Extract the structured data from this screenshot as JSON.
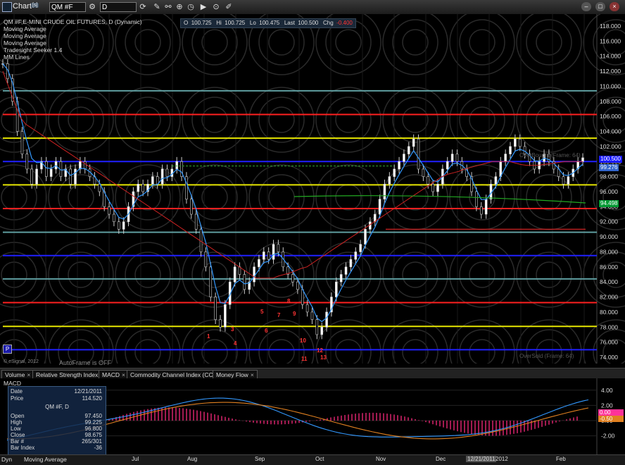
{
  "window": {
    "title": "Chart",
    "badge": "[s]",
    "symbol": "QM #F",
    "interval": "D"
  },
  "legend": {
    "lines": [
      "QM #F,E-MINI CRUDE OIL FUTURES, D (Dynamic)",
      "Moving Average",
      "Moving Average",
      "Moving Average",
      "Tradesight Seeker 1.4",
      "MM Lines"
    ]
  },
  "quote": {
    "o_label": "O",
    "o_value": "100.725",
    "hi_label": "Hi",
    "hi_value": "100.725",
    "lo_label": "Lo",
    "lo_value": "100.475",
    "last_label": "Last",
    "last_value": "100.500",
    "chg_label": "Chg",
    "chg_value": "-0.400"
  },
  "chart_data": {
    "type": "line",
    "price_axis_ticks": [
      "118.000",
      "116.000",
      "114.000",
      "112.000",
      "110.000",
      "108.000",
      "106.000",
      "104.000",
      "102.000",
      "100.000",
      "98.000",
      "96.000",
      "94.000",
      "92.000",
      "90.000",
      "88.000",
      "86.000",
      "84.000",
      "82.000",
      "80.000",
      "78.000",
      "76.000",
      "74.000"
    ],
    "price_tags": [
      {
        "value": "100.500",
        "color": "#1a1aff"
      },
      {
        "value": "99.276",
        "color": "#3366cc"
      },
      {
        "value": "94.498",
        "color": "#009933"
      }
    ],
    "mm_lines": [
      {
        "level": 103.1,
        "color": "#e6e600"
      },
      {
        "level": 106.25,
        "color": "#ff2020"
      },
      {
        "level": 109.4,
        "color": "#5f9ea0"
      },
      {
        "level": 100.0,
        "color": "#2020ff"
      },
      {
        "level": 96.9,
        "color": "#e6e600"
      },
      {
        "level": 93.75,
        "color": "#ff2020"
      },
      {
        "level": 90.6,
        "color": "#5f9ea0"
      },
      {
        "level": 87.5,
        "color": "#2020ff"
      },
      {
        "level": 84.4,
        "color": "#5f9ea0"
      },
      {
        "level": 81.25,
        "color": "#ff2020"
      },
      {
        "level": 78.1,
        "color": "#e6e600"
      },
      {
        "level": 75.0,
        "color": "#2020ff"
      }
    ],
    "price_close": [
      113,
      111,
      108,
      104,
      101,
      99,
      97,
      99,
      100,
      98,
      99,
      100,
      98,
      99,
      97,
      99,
      100,
      99,
      98,
      97,
      96,
      94,
      93,
      92,
      91,
      92,
      94,
      96,
      97,
      96,
      97,
      98,
      97,
      99,
      98,
      99,
      100,
      98,
      95,
      93,
      91,
      88,
      86,
      82,
      79,
      78,
      81,
      84,
      86,
      85,
      83,
      84,
      86,
      87,
      88,
      87,
      89,
      88,
      86,
      85,
      84,
      83,
      81,
      80,
      79,
      77,
      78,
      80,
      82,
      84,
      85,
      86,
      87,
      88,
      89,
      91,
      92,
      93,
      95,
      97,
      98,
      99,
      100,
      101,
      102,
      103,
      99,
      98,
      97,
      96,
      97,
      99,
      100,
      101,
      100,
      99,
      98,
      96,
      94,
      93,
      95,
      97,
      98,
      100,
      101,
      102,
      103,
      102,
      101,
      100,
      99,
      100,
      101,
      100,
      99,
      98,
      97,
      98,
      99,
      100,
      100.5
    ],
    "ma_red": [
      112,
      110,
      108,
      106,
      105,
      104.5,
      104,
      103.5,
      103,
      102.5,
      102,
      101.5,
      101,
      100.5,
      100,
      99.5,
      99,
      98.5,
      98,
      97.5,
      97,
      96.5,
      96,
      95.5,
      95,
      94.5,
      94,
      93.5,
      93,
      92.5,
      92,
      91.5,
      91,
      90.5,
      90,
      89.5,
      89,
      88.5,
      88,
      87.5,
      87,
      86.5,
      86,
      85.5,
      85,
      84.5,
      84.5,
      84.5,
      84.5,
      84.8,
      85,
      85.2,
      85.5,
      85.8,
      86,
      86.5,
      87,
      87.5,
      88,
      88.5,
      89,
      89.5,
      90,
      90.5,
      91,
      91.5,
      92,
      92.5,
      93,
      93.5,
      94,
      94.5,
      95,
      95.5,
      96,
      96.5,
      97,
      97.5,
      98,
      98.3,
      98.5,
      98.7,
      99,
      99.2,
      99.4,
      99.6,
      99.8,
      100,
      100,
      100,
      100,
      99.8,
      99.6,
      99.5,
      99.5,
      99.5,
      99.6,
      99.7,
      99.8,
      99.9,
      100,
      100,
      100,
      100
    ],
    "ma_green_level": 94.5,
    "macd_axis_ticks": [
      "4.00",
      "2.00",
      "0.00",
      "-2.00"
    ],
    "macd_tags": [
      {
        "value": "0.00",
        "color": "#ff3399"
      },
      {
        "value": "-0.50",
        "color": "#e08020"
      }
    ],
    "xaxis_labels": [
      "Jul",
      "Aug",
      "Sep",
      "Oct",
      "Nov",
      "Dec",
      "12/21/2011",
      "2012",
      "Feb"
    ],
    "annotations": [
      "1",
      "2",
      "3",
      "4",
      "5",
      "6",
      "7",
      "8",
      "9",
      "10",
      "11",
      "12",
      "13"
    ],
    "overbought_label": "OverBought (Frame: 64)",
    "oversold_label": "OverSold (Frame: 64)"
  },
  "chart_text": {
    "autoframe": "AutoFrame is OFF",
    "copyright": "© eSignal, 2012",
    "p_badge": "P"
  },
  "tabs": [
    {
      "label": "Volume"
    },
    {
      "label": "Relative Strength Index"
    },
    {
      "label": "MACD"
    },
    {
      "label": "Commodity Channel Index (CCI)"
    },
    {
      "label": "Money Flow"
    }
  ],
  "macd_panel": {
    "title": "MACD"
  },
  "databox": {
    "date_label": "Date",
    "date_value": "12/21/2011",
    "price_label": "Price",
    "price_value": "114.520",
    "symbol": "QM #F, D",
    "open_label": "Open",
    "open_value": "97.450",
    "high_label": "High",
    "high_value": "99.225",
    "low_label": "Low",
    "low_value": "96.800",
    "close_label": "Close",
    "close_value": "98.675",
    "bar_label": "Bar #",
    "bar_value": "265/301",
    "barindex_label": "Bar Index",
    "barindex_value": "-36"
  },
  "status": {
    "dyn": "Dyn",
    "ma": "Moving Average"
  }
}
